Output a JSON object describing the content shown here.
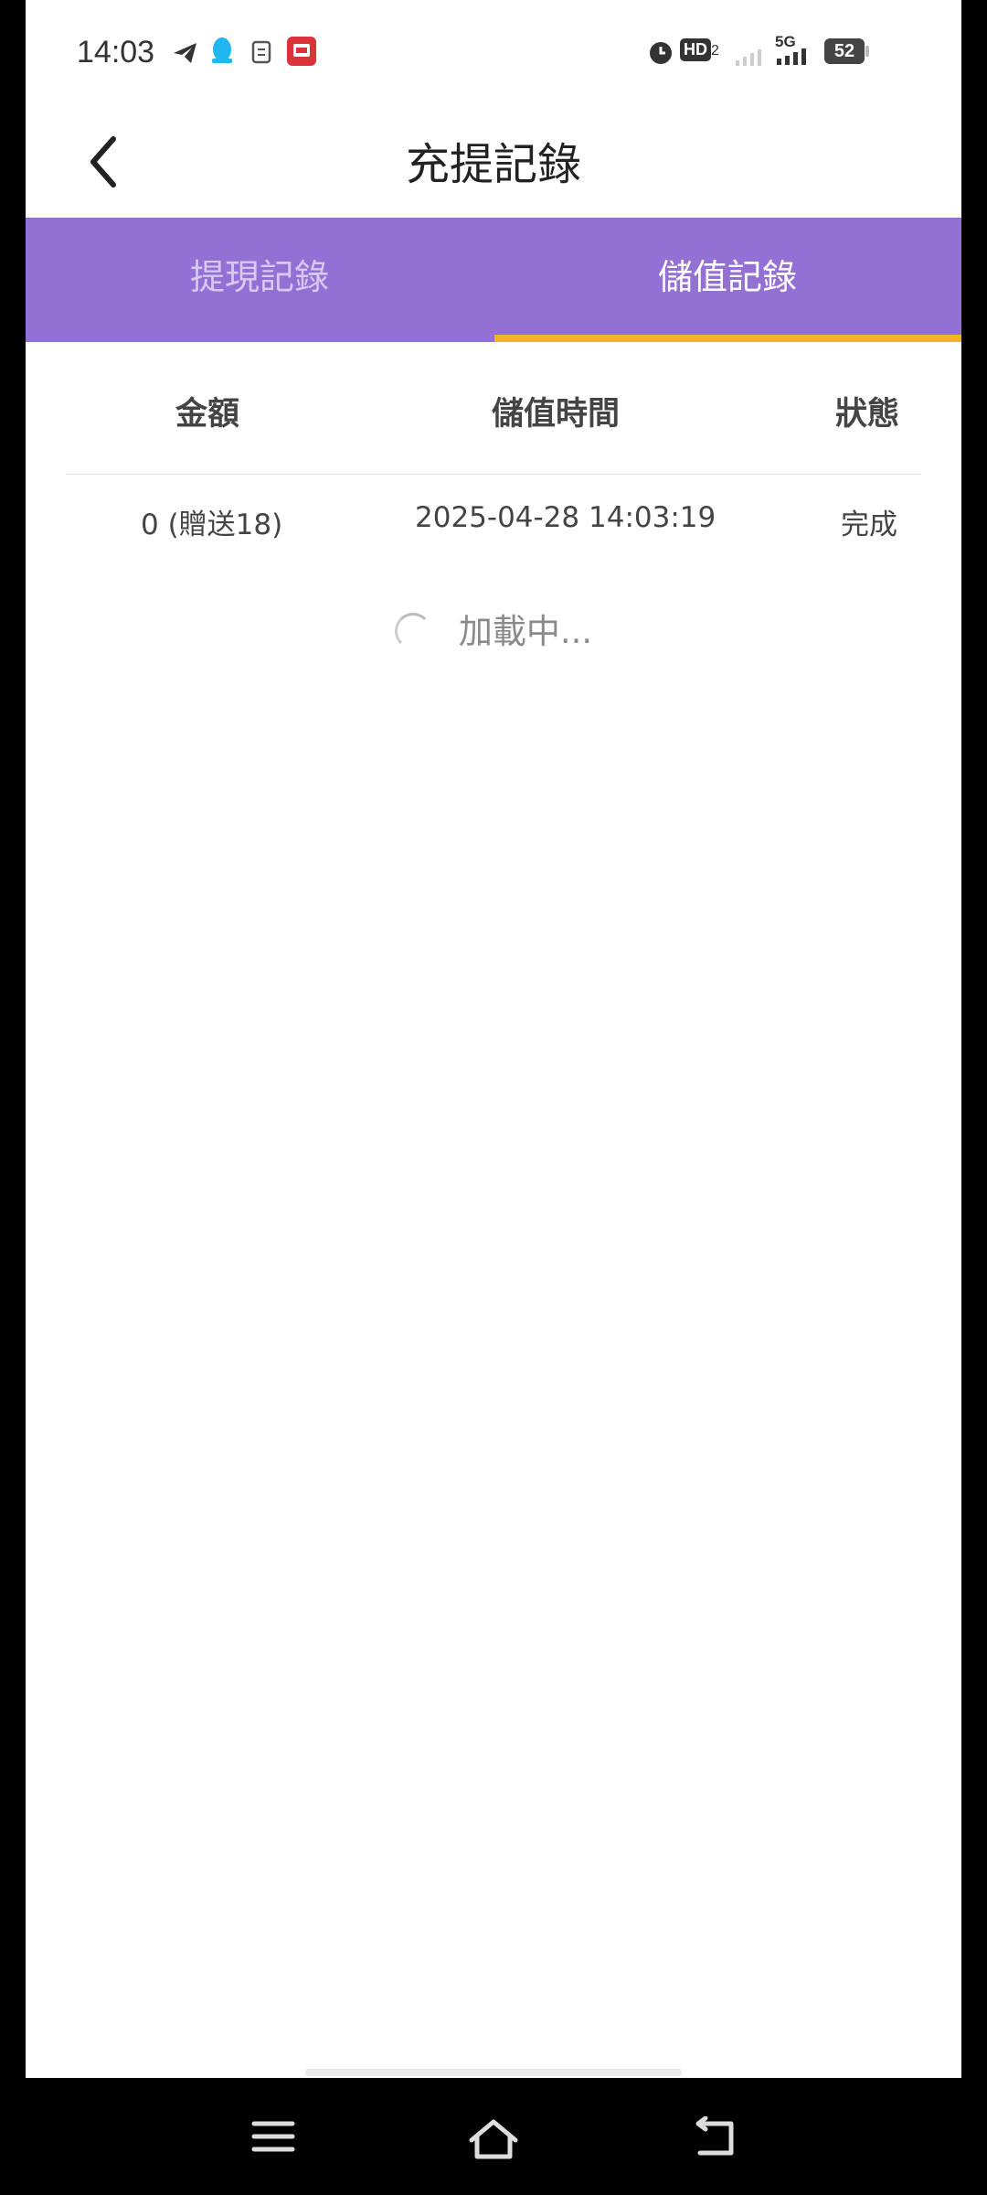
{
  "status_bar": {
    "time": "14:03",
    "icons": [
      "telegram-icon",
      "qq-icon",
      "file-icon",
      "app-icon",
      "alarm-icon",
      "hd-icon",
      "signal-icon",
      "5g-signal-icon",
      "battery-icon"
    ],
    "battery": "52",
    "network": "5G",
    "hd_label": "HD"
  },
  "header": {
    "title": "充提記錄",
    "back_icon": "chevron-left-icon"
  },
  "tabs": {
    "items": [
      {
        "label": "提現記錄"
      },
      {
        "label": "儲值記錄"
      }
    ],
    "active_index": 1,
    "accent_color": "#9370D4",
    "indicator_color": "#F0B428"
  },
  "table": {
    "headers": [
      "金額",
      "儲值時間",
      "狀態"
    ],
    "rows": [
      {
        "amount": "0 (贈送18)",
        "time": "2025-04-28 14:03:19",
        "status": "完成"
      }
    ]
  },
  "loading_text": "加載中...",
  "nav_bar": {
    "icons": [
      "menu-icon",
      "home-icon",
      "back-icon"
    ]
  }
}
